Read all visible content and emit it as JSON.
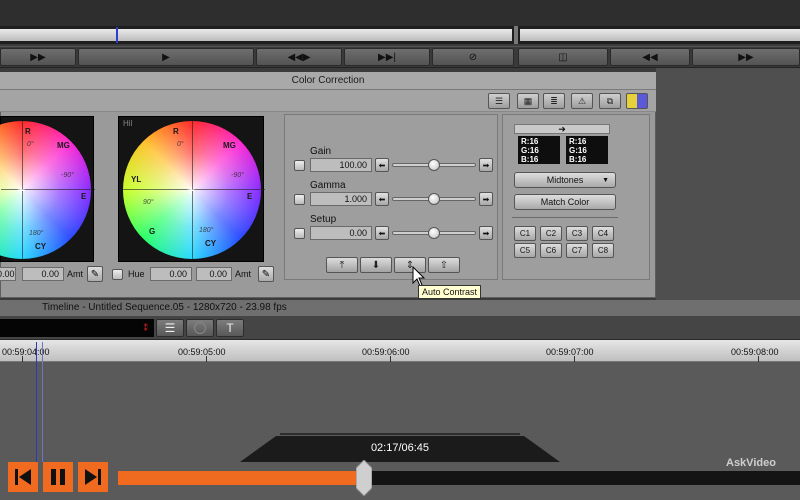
{
  "colors": {
    "accent_orange": "#f06a1f",
    "panel_gray": "#9a9a9a",
    "timeline_marker": "#2838c8",
    "tooltip_bg": "#ffffcf"
  },
  "icons": {
    "back": "back-arrow-icon",
    "play": "play-icon",
    "pause": "pause-icon",
    "skip_prev": "skip-previous-icon",
    "skip_next": "skip-next-icon"
  },
  "transport": {
    "buttons": [
      "▶▶",
      "▶",
      "◀◀▶",
      "▶▶|",
      "⊘",
      "◫",
      "◀◀",
      "▶▶"
    ]
  },
  "color_correction": {
    "title": "Color Correction",
    "wheel1": {
      "labels": {
        "r": "R",
        "mg": "MG",
        "e": "E",
        "cy": "CY"
      },
      "degrees": {
        "d0": "0°",
        "d90n": "-90°",
        "d180": "180°"
      }
    },
    "wheel2": {
      "corner": "Hil",
      "labels": {
        "r": "R",
        "mg": "MG",
        "yl": "YL",
        "e": "E",
        "g": "G",
        "cy": "CY"
      },
      "degrees": {
        "d0": "0°",
        "d90n": "-90°",
        "d90": "90°",
        "d180": "180°"
      }
    },
    "row": {
      "val1": "0.00",
      "val2": "0.00",
      "amt": "Amt",
      "hue": "Hue",
      "val3": "0.00",
      "val4": "0.00",
      "amt2": "Amt"
    },
    "controls": [
      {
        "label": "Gain",
        "value": "100.00",
        "knob": 0.5
      },
      {
        "label": "Gamma",
        "value": "1.000",
        "knob": 0.5
      },
      {
        "label": "Setup",
        "value": "0.00",
        "knob": 0.5
      }
    ],
    "rgb": {
      "left": {
        "r": "R:16",
        "g": "G:16",
        "b": "B:16"
      },
      "right": {
        "r": "R:16",
        "g": "G:16",
        "b": "B:16"
      },
      "arrow": "➜"
    },
    "midtones": "Midtones",
    "match_color": "Match Color",
    "c_buttons": [
      "C1",
      "C2",
      "C3",
      "C4",
      "C5",
      "C6",
      "C7",
      "C8"
    ],
    "tooltip": "Auto Contrast"
  },
  "timeline": {
    "title": "Timeline - Untitled Sequence.05 - 1280x720 - 23.98 fps",
    "timecodes": [
      "00:59:04:00",
      "00:59:05:00",
      "00:59:06:00",
      "00:59:07:00",
      "00:59:08:00"
    ],
    "text_tool": "T"
  },
  "player": {
    "time": "02:17/06:45",
    "progress": 0.36,
    "watermark": "AskVideo"
  }
}
